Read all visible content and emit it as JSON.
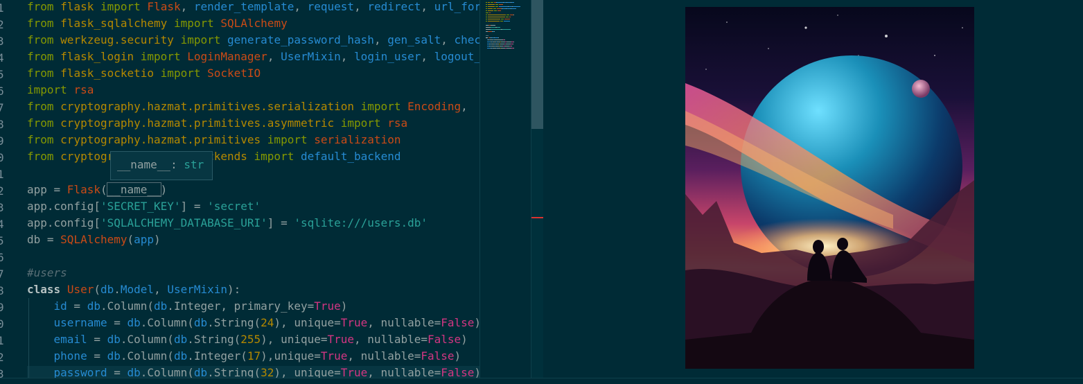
{
  "editor": {
    "line_numbers": [
      "1",
      "2",
      "3",
      "4",
      "5",
      "6",
      "7",
      "8",
      "9",
      "0",
      "1",
      "2",
      "3",
      "4",
      "5",
      "6",
      "7",
      "8",
      "9",
      "0",
      "1",
      "2",
      "3"
    ],
    "lines": [
      [
        [
          "kw",
          "from"
        ],
        [
          "t",
          " "
        ],
        [
          "m",
          "flask"
        ],
        [
          "t",
          " "
        ],
        [
          "kw",
          "import"
        ],
        [
          "t",
          " "
        ],
        [
          "d",
          "Flask"
        ],
        [
          "t",
          ", "
        ],
        [
          "n",
          "render_template"
        ],
        [
          "t",
          ", "
        ],
        [
          "n",
          "request"
        ],
        [
          "t",
          ", "
        ],
        [
          "n",
          "redirect"
        ],
        [
          "t",
          ", "
        ],
        [
          "n",
          "url_for"
        ]
      ],
      [
        [
          "kw",
          "from"
        ],
        [
          "t",
          " "
        ],
        [
          "m",
          "flask_sqlalchemy"
        ],
        [
          "t",
          " "
        ],
        [
          "kw",
          "import"
        ],
        [
          "t",
          " "
        ],
        [
          "d",
          "SQLAlchemy"
        ]
      ],
      [
        [
          "kw",
          "from"
        ],
        [
          "t",
          " "
        ],
        [
          "m",
          "werkzeug.security"
        ],
        [
          "t",
          " "
        ],
        [
          "kw",
          "import"
        ],
        [
          "t",
          " "
        ],
        [
          "n",
          "generate_password_hash"
        ],
        [
          "t",
          ", "
        ],
        [
          "n",
          "gen_salt"
        ],
        [
          "t",
          ", "
        ],
        [
          "n",
          "check_password_hash"
        ]
      ],
      [
        [
          "kw",
          "from"
        ],
        [
          "t",
          " "
        ],
        [
          "m",
          "flask_login"
        ],
        [
          "t",
          " "
        ],
        [
          "kw",
          "import"
        ],
        [
          "t",
          " "
        ],
        [
          "d",
          "LoginManager"
        ],
        [
          "t",
          ", "
        ],
        [
          "n",
          "UserMixin"
        ],
        [
          "t",
          ", "
        ],
        [
          "n",
          "login_user"
        ],
        [
          "t",
          ", "
        ],
        [
          "n",
          "logout_user"
        ]
      ],
      [
        [
          "kw",
          "from"
        ],
        [
          "t",
          " "
        ],
        [
          "m",
          "flask_socketio"
        ],
        [
          "t",
          " "
        ],
        [
          "kw",
          "import"
        ],
        [
          "t",
          " "
        ],
        [
          "d",
          "SocketIO"
        ]
      ],
      [
        [
          "kw",
          "import"
        ],
        [
          "t",
          " "
        ],
        [
          "d",
          "rsa"
        ]
      ],
      [
        [
          "kw",
          "from"
        ],
        [
          "t",
          " "
        ],
        [
          "m",
          "cryptography.hazmat.primitives.serialization"
        ],
        [
          "t",
          " "
        ],
        [
          "kw",
          "import"
        ],
        [
          "t",
          " "
        ],
        [
          "d",
          "Encoding"
        ],
        [
          "t",
          ","
        ]
      ],
      [
        [
          "kw",
          "from"
        ],
        [
          "t",
          " "
        ],
        [
          "m",
          "cryptography.hazmat.primitives.asymmetric"
        ],
        [
          "t",
          " "
        ],
        [
          "kw",
          "import"
        ],
        [
          "t",
          " "
        ],
        [
          "d",
          "rsa"
        ]
      ],
      [
        [
          "kw",
          "from"
        ],
        [
          "t",
          " "
        ],
        [
          "m",
          "cryptography.hazmat.primitives"
        ],
        [
          "t",
          " "
        ],
        [
          "kw",
          "import"
        ],
        [
          "t",
          " "
        ],
        [
          "d",
          "serialization"
        ]
      ],
      [
        [
          "kw",
          "from"
        ],
        [
          "t",
          " "
        ],
        [
          "m",
          "cryptography.hazmat.backends"
        ],
        [
          "t",
          " "
        ],
        [
          "kw",
          "import"
        ],
        [
          "t",
          " "
        ],
        [
          "n",
          "default_backend"
        ]
      ],
      [],
      [
        [
          "t",
          "app = "
        ],
        [
          "d",
          "Flask"
        ],
        [
          "t",
          "("
        ],
        [
          "hl",
          "__name__"
        ],
        [
          "t",
          ")"
        ]
      ],
      [
        [
          "t",
          "app."
        ],
        [
          "t",
          "config"
        ],
        [
          "t",
          "["
        ],
        [
          "s",
          "'SECRET_KEY'"
        ],
        [
          "t",
          "] = "
        ],
        [
          "s",
          "'secret'"
        ]
      ],
      [
        [
          "t",
          "app."
        ],
        [
          "t",
          "config"
        ],
        [
          "t",
          "["
        ],
        [
          "s",
          "'SQLALCHEMY_DATABASE_URI'"
        ],
        [
          "t",
          "] = "
        ],
        [
          "s",
          "'sqlite:///users.db'"
        ]
      ],
      [
        [
          "t",
          "db = "
        ],
        [
          "d",
          "SQLAlchemy"
        ],
        [
          "t",
          "("
        ],
        [
          "n",
          "app"
        ],
        [
          "t",
          ")"
        ]
      ],
      [],
      [
        [
          "c",
          "#users"
        ]
      ],
      [
        [
          "k",
          "class"
        ],
        [
          "t",
          " "
        ],
        [
          "d",
          "User"
        ],
        [
          "t",
          "("
        ],
        [
          "n",
          "db"
        ],
        [
          "t",
          "."
        ],
        [
          "n",
          "Model"
        ],
        [
          "t",
          ", "
        ],
        [
          "n",
          "UserMixin"
        ],
        [
          "t",
          "):"
        ]
      ],
      [
        [
          "t",
          "    "
        ],
        [
          "n",
          "id"
        ],
        [
          "t",
          " = "
        ],
        [
          "n",
          "db"
        ],
        [
          "t",
          ".Column("
        ],
        [
          "n",
          "db"
        ],
        [
          "t",
          ".Integer, primary_key="
        ],
        [
          "b",
          "True"
        ],
        [
          "t",
          ")"
        ]
      ],
      [
        [
          "t",
          "    "
        ],
        [
          "n",
          "username"
        ],
        [
          "t",
          " = "
        ],
        [
          "n",
          "db"
        ],
        [
          "t",
          ".Column("
        ],
        [
          "n",
          "db"
        ],
        [
          "t",
          ".String("
        ],
        [
          "m",
          "24"
        ],
        [
          "t",
          "), unique="
        ],
        [
          "b",
          "True"
        ],
        [
          "t",
          ", nullable="
        ],
        [
          "b",
          "False"
        ],
        [
          "t",
          ")"
        ]
      ],
      [
        [
          "t",
          "    "
        ],
        [
          "n",
          "email"
        ],
        [
          "t",
          " = "
        ],
        [
          "n",
          "db"
        ],
        [
          "t",
          ".Column("
        ],
        [
          "n",
          "db"
        ],
        [
          "t",
          ".String("
        ],
        [
          "m",
          "255"
        ],
        [
          "t",
          "), unique="
        ],
        [
          "b",
          "True"
        ],
        [
          "t",
          ", nullable="
        ],
        [
          "b",
          "False"
        ],
        [
          "t",
          ")"
        ]
      ],
      [
        [
          "t",
          "    "
        ],
        [
          "n",
          "phone"
        ],
        [
          "t",
          " = "
        ],
        [
          "n",
          "db"
        ],
        [
          "t",
          ".Column("
        ],
        [
          "n",
          "db"
        ],
        [
          "t",
          ".Integer("
        ],
        [
          "m",
          "17"
        ],
        [
          "t",
          "),unique="
        ],
        [
          "b",
          "True"
        ],
        [
          "t",
          ", nullable="
        ],
        [
          "b",
          "False"
        ],
        [
          "t",
          ")"
        ]
      ],
      [
        [
          "t",
          "    "
        ],
        [
          "n",
          "password"
        ],
        [
          "t",
          " = "
        ],
        [
          "n",
          "db"
        ],
        [
          "t",
          ".Column("
        ],
        [
          "n",
          "db"
        ],
        [
          "t",
          ".String("
        ],
        [
          "m",
          "32"
        ],
        [
          "t",
          "), unique="
        ],
        [
          "b",
          "True"
        ],
        [
          "t",
          ", nullable="
        ],
        [
          "b",
          "False"
        ],
        [
          "t",
          ")"
        ]
      ]
    ]
  },
  "hover": {
    "name": "__name__",
    "sep": ": ",
    "type": "str"
  },
  "colors": {
    "background": "#002b36",
    "keyword": "#859900",
    "module": "#b58900",
    "name": "#268bd2",
    "class": "#cb4b16",
    "string": "#2aa198",
    "constant": "#d33682",
    "comment": "#586e75",
    "error_marker": "#dc322f"
  },
  "preview": {
    "artwork_icon": "space-landscape-image"
  }
}
